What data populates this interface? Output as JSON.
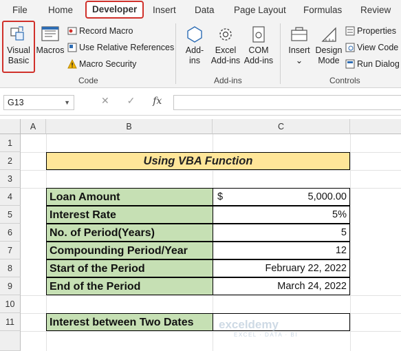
{
  "ribbon_tabs": [
    "File",
    "Home",
    "Developer",
    "Insert",
    "Data",
    "Page Layout",
    "Formulas",
    "Review"
  ],
  "code_group": {
    "visual_basic": [
      "Visual",
      "Basic"
    ],
    "macros": "Macros",
    "record_macro": "Record Macro",
    "relative_refs": "Use Relative References",
    "macro_security": "Macro Security",
    "label": "Code"
  },
  "addins_group": {
    "addins": [
      "Add-",
      "ins"
    ],
    "excel_addins": [
      "Excel",
      "Add-ins"
    ],
    "com_addins": [
      "COM",
      "Add-ins"
    ],
    "label": "Add-ins"
  },
  "controls_group": {
    "insert": "Insert",
    "insert_arrow": "⌄",
    "design_mode": [
      "Design",
      "Mode"
    ],
    "properties": "Properties",
    "view_code": "View Code",
    "run_dialog": "Run Dialog",
    "label": "Controls"
  },
  "formula_bar": {
    "name_box": "G13",
    "dropdown": "▼",
    "cancel": "✕",
    "enter": "✓",
    "fx": "fx"
  },
  "columns": [
    "A",
    "B",
    "C"
  ],
  "rows": [
    "1",
    "2",
    "3",
    "4",
    "5",
    "6",
    "7",
    "8",
    "9",
    "10",
    "11"
  ],
  "sheet": {
    "title": "Using VBA Function",
    "labels": [
      "Loan Amount",
      "Interest Rate",
      "No. of Period(Years)",
      "Compounding Period/Year",
      "Start of the Period",
      "End of the Period"
    ],
    "values": [
      "5,000.00",
      "5%",
      "5",
      "12",
      "February 22, 2022",
      "March 24, 2022"
    ],
    "currency_symbol": "$",
    "result_label": "Interest between Two Dates",
    "result_value": ""
  },
  "watermark": {
    "name": "exceldemy",
    "tagline": "EXCEL · DATA · BI"
  }
}
